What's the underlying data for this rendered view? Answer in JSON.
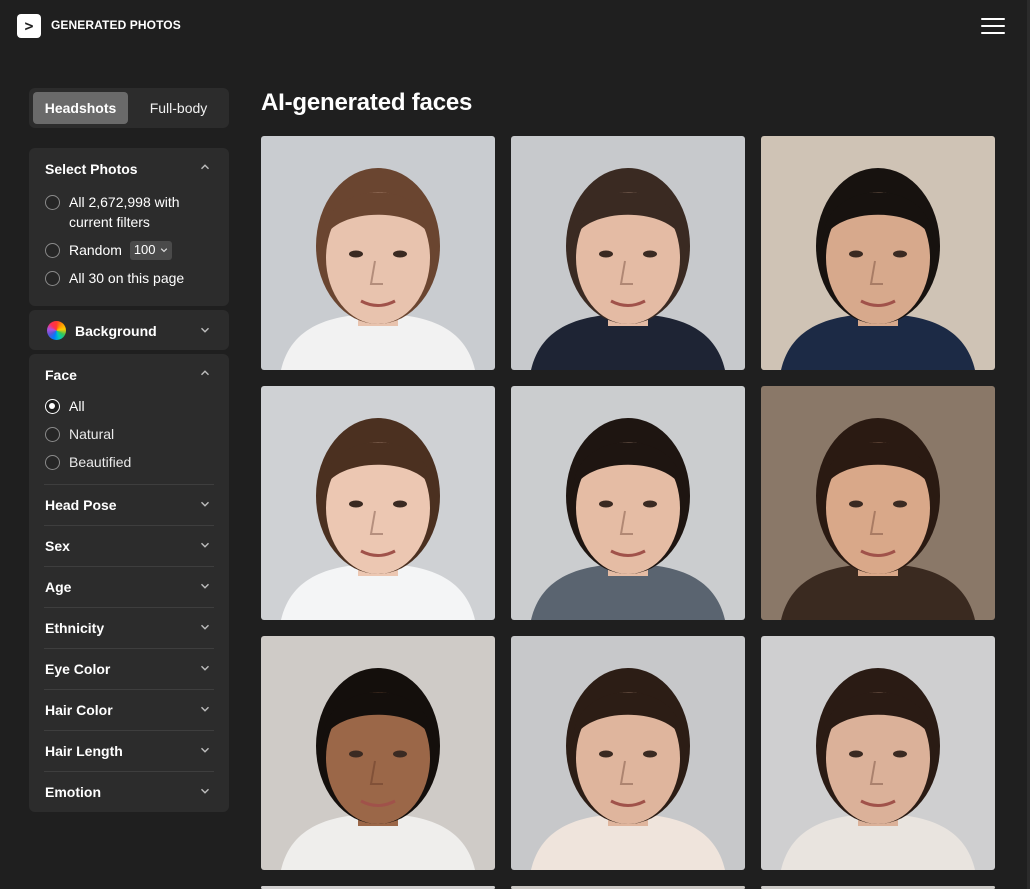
{
  "header": {
    "logo_glyph": ">",
    "brand": "GENERATED PHOTOS"
  },
  "tabs": {
    "active": "Headshots",
    "inactive": "Full-body"
  },
  "select_photos": {
    "title": "Select Photos",
    "options": [
      {
        "label_line1": "All 2,672,998 with",
        "label_line2": "current filters",
        "selected": false
      },
      {
        "label": "Random",
        "dropdown_value": "100",
        "selected": false
      },
      {
        "label": "All 30 on this page",
        "selected": false
      }
    ]
  },
  "background": {
    "label": "Background"
  },
  "face": {
    "title": "Face",
    "options": [
      {
        "label": "All",
        "selected": true
      },
      {
        "label": "Natural",
        "selected": false
      },
      {
        "label": "Beautified",
        "selected": false
      }
    ]
  },
  "filters": [
    {
      "label": "Head Pose"
    },
    {
      "label": "Sex"
    },
    {
      "label": "Age"
    },
    {
      "label": "Ethnicity"
    },
    {
      "label": "Eye Color"
    },
    {
      "label": "Hair Color"
    },
    {
      "label": "Hair Length"
    },
    {
      "label": "Emotion"
    }
  ],
  "main": {
    "title": "AI-generated faces"
  },
  "photos": [
    {
      "bg": "#c9ccd0",
      "skin": "#e8c3ae",
      "hair": "#6a4530",
      "shirt": "#f2f2f2"
    },
    {
      "bg": "#c7c9cc",
      "skin": "#e4bba4",
      "hair": "#3a2a22",
      "shirt": "#1e2434"
    },
    {
      "bg": "#cfc3b5",
      "skin": "#d7a98c",
      "hair": "#17120f",
      "shirt": "#1c2a45"
    },
    {
      "bg": "#cfd1d4",
      "skin": "#ecc7b2",
      "hair": "#4b3020",
      "shirt": "#f4f5f6"
    },
    {
      "bg": "#cbcdcf",
      "skin": "#e5bca4",
      "hair": "#1e1511",
      "shirt": "#5a6470"
    },
    {
      "bg": "#8a7868",
      "skin": "#d9a889",
      "hair": "#2a1a12",
      "shirt": "#3a2a20"
    },
    {
      "bg": "#cfcbc7",
      "skin": "#9b6748",
      "hair": "#140f0c",
      "shirt": "#efeeec"
    },
    {
      "bg": "#c7c8ca",
      "skin": "#dfb59d",
      "hair": "#2c1d15",
      "shirt": "#efe4dc"
    },
    {
      "bg": "#cfcfd0",
      "skin": "#dbb199",
      "hair": "#2a1b14",
      "shirt": "#e9e4df"
    }
  ],
  "colors": {
    "page_bg": "#1f1f1f",
    "panel_bg": "#2c2c2c",
    "tab_active_bg": "#6a6a6a"
  }
}
